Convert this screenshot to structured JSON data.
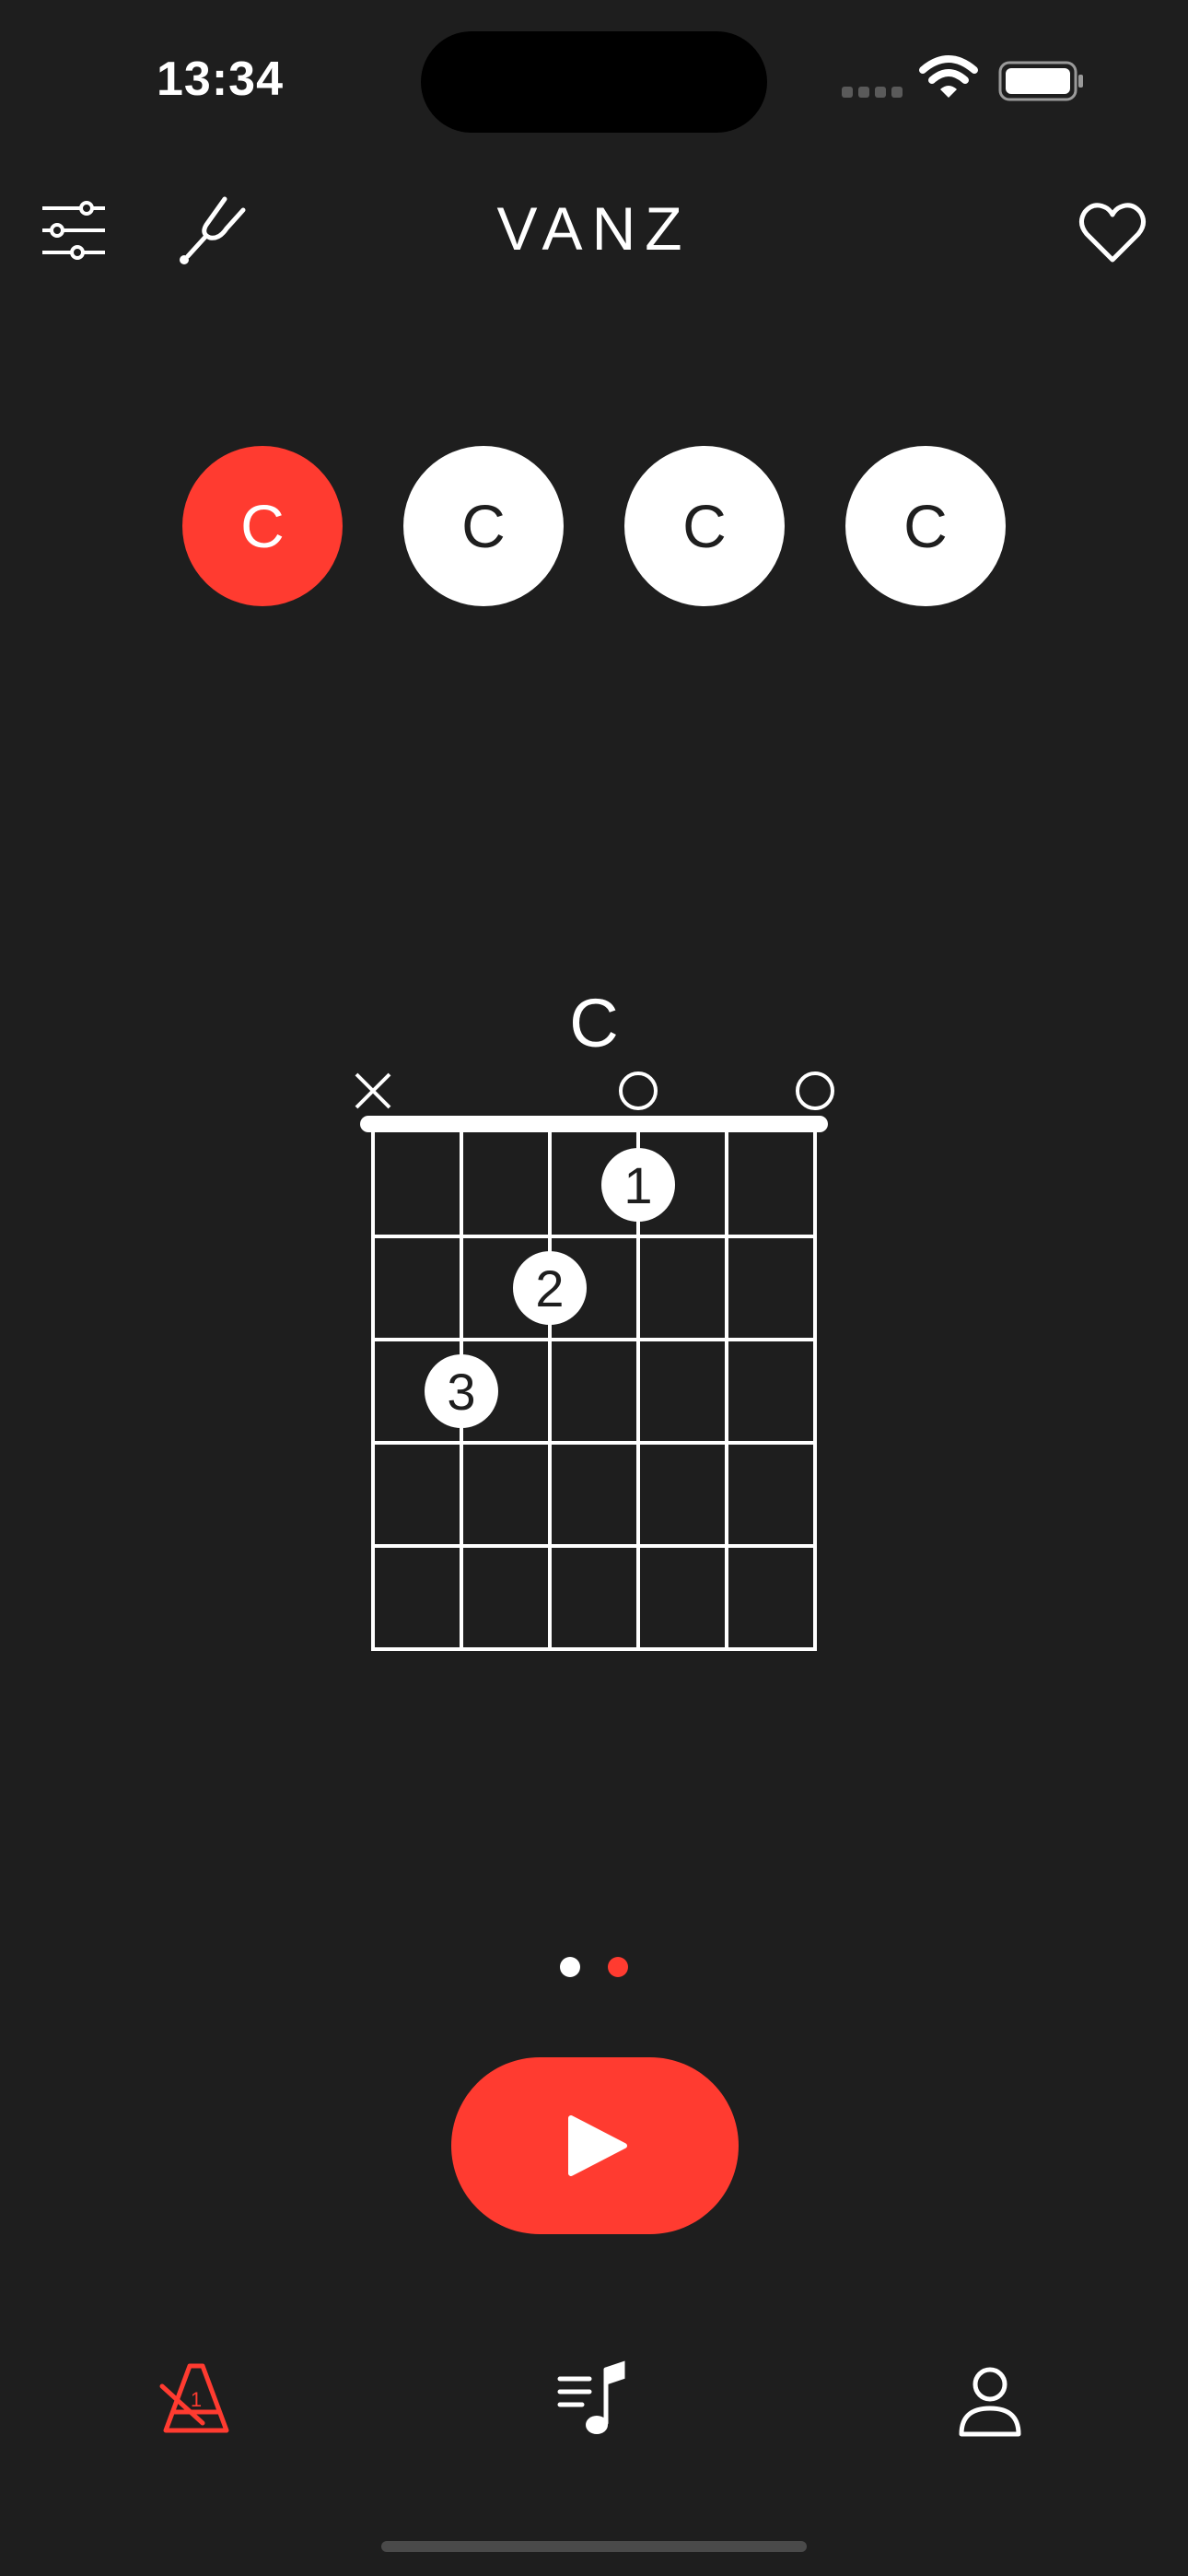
{
  "status_bar": {
    "time": "13:34"
  },
  "header": {
    "title": "VANZ"
  },
  "chord_selector": {
    "chords": [
      {
        "label": "C",
        "active": true
      },
      {
        "label": "C",
        "active": false
      },
      {
        "label": "C",
        "active": false
      },
      {
        "label": "C",
        "active": false
      }
    ]
  },
  "chord_diagram": {
    "name": "C",
    "string_markers": [
      "×",
      "",
      "",
      "○",
      "",
      "○"
    ],
    "fingers": [
      {
        "label": "1",
        "string": 4,
        "fret": 1
      },
      {
        "label": "2",
        "string": 3,
        "fret": 2
      },
      {
        "label": "3",
        "string": 2,
        "fret": 3
      }
    ],
    "frets": 5,
    "strings": 6
  },
  "pager": {
    "count": 2,
    "active_index": 1
  },
  "colors": {
    "accent": "#ff3b30",
    "background": "#1e1e1e",
    "foreground": "#ffffff",
    "inactive": "#5a5a5a"
  },
  "icons": {
    "header_left": [
      "sliders-icon",
      "tuning-fork-icon"
    ],
    "header_right": "heart-icon",
    "play": "play-icon",
    "tabs": [
      "metronome-icon",
      "music-library-icon",
      "profile-icon"
    ]
  }
}
